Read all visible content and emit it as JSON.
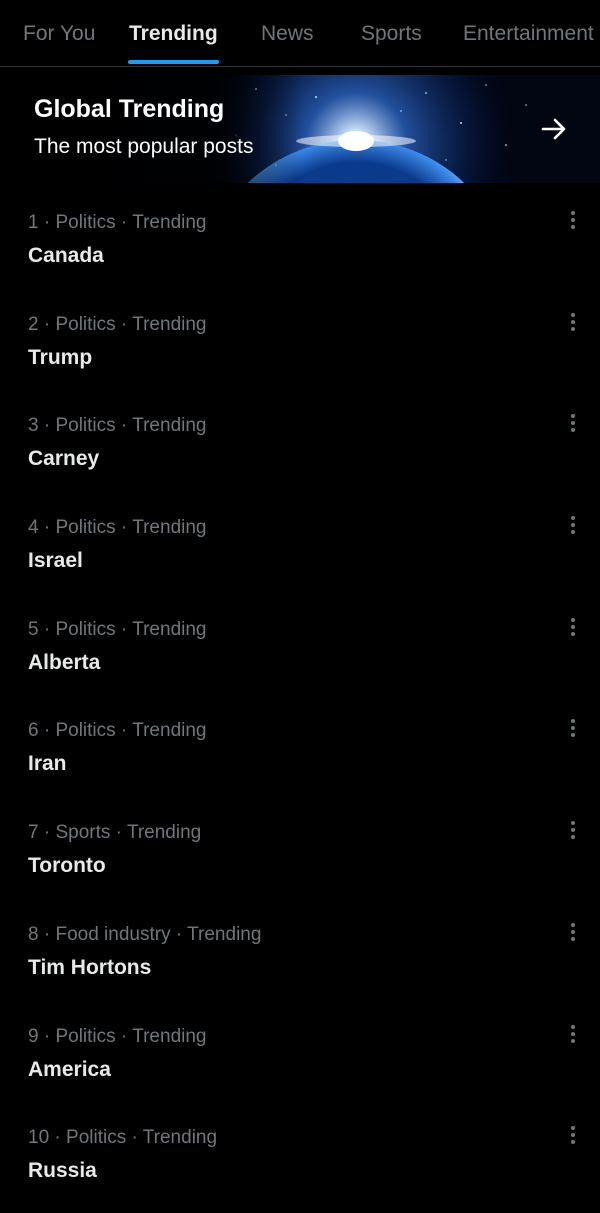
{
  "tabs": [
    {
      "label": "For You",
      "active": false
    },
    {
      "label": "Trending",
      "active": true
    },
    {
      "label": "News",
      "active": false
    },
    {
      "label": "Sports",
      "active": false
    },
    {
      "label": "Entertainment",
      "active": false
    }
  ],
  "banner": {
    "title": "Global Trending",
    "subtitle": "The most popular posts",
    "arrow_icon": "arrow-right-icon"
  },
  "trends": [
    {
      "rank": "1",
      "category": "Politics",
      "status": "Trending",
      "name": "Canada"
    },
    {
      "rank": "2",
      "category": "Politics",
      "status": "Trending",
      "name": "Trump"
    },
    {
      "rank": "3",
      "category": "Politics",
      "status": "Trending",
      "name": "Carney"
    },
    {
      "rank": "4",
      "category": "Politics",
      "status": "Trending",
      "name": "Israel"
    },
    {
      "rank": "5",
      "category": "Politics",
      "status": "Trending",
      "name": "Alberta"
    },
    {
      "rank": "6",
      "category": "Politics",
      "status": "Trending",
      "name": "Iran"
    },
    {
      "rank": "7",
      "category": "Sports",
      "status": "Trending",
      "name": "Toronto"
    },
    {
      "rank": "8",
      "category": "Food industry",
      "status": "Trending",
      "name": "Tim Hortons"
    },
    {
      "rank": "9",
      "category": "Politics",
      "status": "Trending",
      "name": "America"
    },
    {
      "rank": "10",
      "category": "Politics",
      "status": "Trending",
      "name": "Russia"
    }
  ],
  "colors": {
    "background": "#000000",
    "accent": "#1d9bf0",
    "text_primary": "#e7e9ea",
    "text_secondary": "#71767b"
  },
  "icons": {
    "more": "more-vertical-icon"
  }
}
